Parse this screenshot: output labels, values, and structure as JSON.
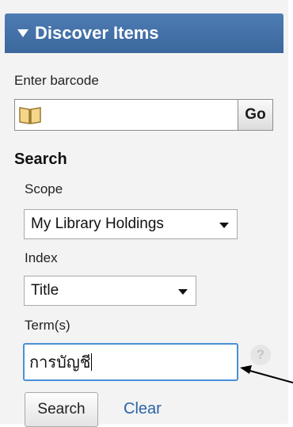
{
  "panel": {
    "header_title": "Discover Items"
  },
  "barcode": {
    "label": "Enter barcode",
    "value": "",
    "go_label": "Go"
  },
  "search": {
    "section_title": "Search",
    "scope": {
      "label": "Scope",
      "selected": "My Library Holdings"
    },
    "index": {
      "label": "Index",
      "selected": "Title"
    },
    "terms": {
      "label": "Term(s)",
      "value": "การบัญชี"
    },
    "help_label": "?",
    "search_button": "Search",
    "clear_link": "Clear"
  },
  "colors": {
    "header_bg": "#3f6ea5",
    "link": "#2b64a6",
    "focus_border": "#4a90d9"
  }
}
